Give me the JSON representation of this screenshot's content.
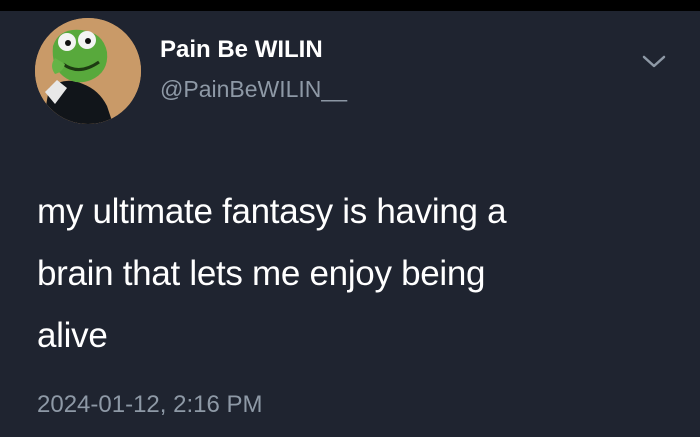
{
  "tweet": {
    "author": {
      "display_name": "Pain Be WILIN",
      "handle": "@PainBeWILIN__",
      "avatar_icon": "kermit-frog-avatar-icon"
    },
    "text_lines": [
      "my ultimate fantasy is having a",
      "brain that lets me enjoy being",
      "alive"
    ],
    "timestamp": "2024-01-12, 2:16 PM",
    "menu_icon": "chevron-down-icon"
  },
  "colors": {
    "background": "#1f2430",
    "primary_text": "#ffffff",
    "secondary_text": "#8e99a6",
    "avatar_background": "#c99a68",
    "frog_green": "#58a93c"
  }
}
